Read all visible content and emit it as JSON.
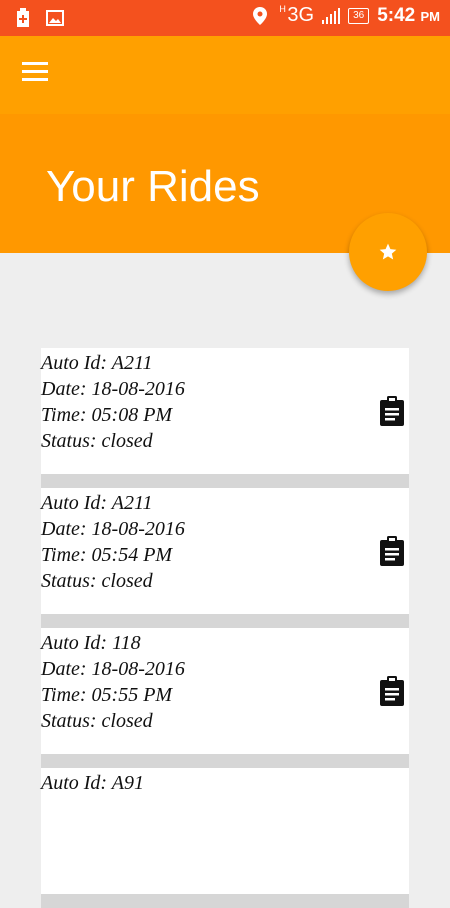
{
  "status_bar": {
    "network": "3G",
    "network_prefix": "H",
    "battery": "36",
    "time": "5:42",
    "ampm": "PM"
  },
  "header": {
    "title": "Your Rides"
  },
  "rides": [
    {
      "auto_id": "Auto Id: A211",
      "date": "Date: 18-08-2016",
      "time": "Time: 05:08 PM",
      "status": "Status: closed"
    },
    {
      "auto_id": "Auto Id: A211",
      "date": "Date: 18-08-2016",
      "time": "Time: 05:54 PM",
      "status": "Status: closed"
    },
    {
      "auto_id": "Auto Id: 118",
      "date": "Date: 18-08-2016",
      "time": "Time: 05:55 PM",
      "status": "Status: closed"
    },
    {
      "auto_id": "Auto Id: A91",
      "date": "",
      "time": "",
      "status": ""
    }
  ],
  "icons": {
    "menu": "hamburger-menu-icon",
    "fab": "star-icon",
    "ride_action": "clipboard-icon"
  },
  "colors": {
    "status_bar": "#f4511e",
    "toolbar": "#ffa000",
    "header": "#ff9800",
    "fab": "#ffa000",
    "background": "#eeeeee"
  }
}
